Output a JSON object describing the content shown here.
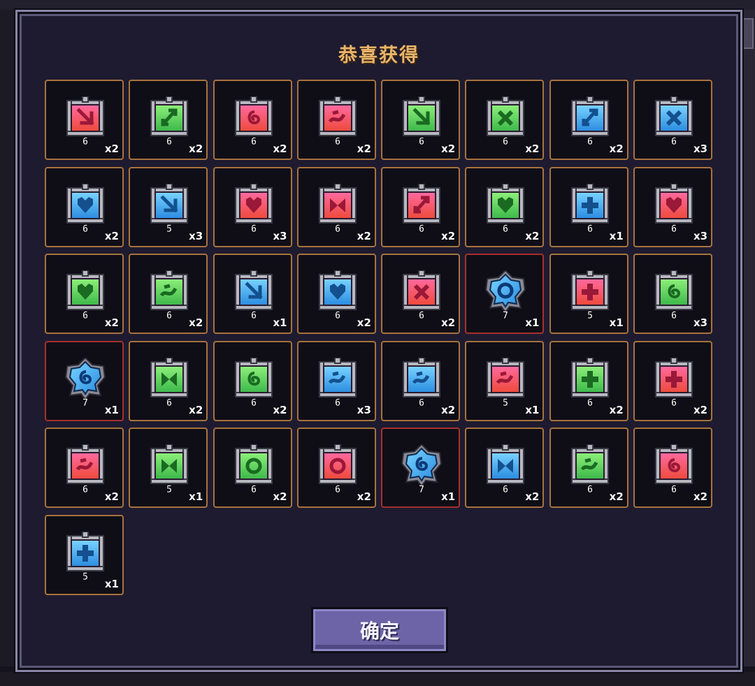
{
  "dialog": {
    "title": "恭喜获得",
    "confirm_label": "确定"
  },
  "colors": {
    "red": {
      "top": "#ff6aa0",
      "bottom": "#ee4a3a",
      "glyph": "#9a1838"
    },
    "green": {
      "top": "#8ef07a",
      "bottom": "#3cb84a",
      "glyph": "#1a6a22"
    },
    "blue": {
      "top": "#7ad4ff",
      "bottom": "#2a8ce0",
      "glyph": "#14508e"
    },
    "frame": "#b8b8c0",
    "cell_border": "#a8733c",
    "special_border": "#a8302c"
  },
  "items": [
    {
      "color": "red",
      "type": "scroll",
      "level": "6",
      "qty": "x2",
      "icon": "arrow-down-right"
    },
    {
      "color": "green",
      "type": "scroll",
      "level": "6",
      "qty": "x2",
      "icon": "slash-arrows"
    },
    {
      "color": "red",
      "type": "scroll",
      "level": "6",
      "qty": "x2",
      "icon": "swirl"
    },
    {
      "color": "red",
      "type": "scroll",
      "level": "6",
      "qty": "x2",
      "icon": "wave"
    },
    {
      "color": "green",
      "type": "scroll",
      "level": "6",
      "qty": "x2",
      "icon": "arrow-down-right"
    },
    {
      "color": "green",
      "type": "scroll",
      "level": "6",
      "qty": "x2",
      "icon": "cross-x"
    },
    {
      "color": "blue",
      "type": "scroll",
      "level": "6",
      "qty": "x2",
      "icon": "slash-arrows"
    },
    {
      "color": "blue",
      "type": "scroll",
      "level": "6",
      "qty": "x3",
      "icon": "cross-x"
    },
    {
      "color": "blue",
      "type": "scroll",
      "level": "6",
      "qty": "x2",
      "icon": "heart"
    },
    {
      "color": "blue",
      "type": "scroll",
      "level": "5",
      "qty": "x3",
      "icon": "arrow-down-right"
    },
    {
      "color": "red",
      "type": "scroll",
      "level": "6",
      "qty": "x3",
      "icon": "heart"
    },
    {
      "color": "red",
      "type": "scroll",
      "level": "6",
      "qty": "x2",
      "icon": "bowtie"
    },
    {
      "color": "red",
      "type": "scroll",
      "level": "6",
      "qty": "x2",
      "icon": "slash-arrows"
    },
    {
      "color": "green",
      "type": "scroll",
      "level": "6",
      "qty": "x2",
      "icon": "heart"
    },
    {
      "color": "blue",
      "type": "scroll",
      "level": "6",
      "qty": "x1",
      "icon": "plus"
    },
    {
      "color": "red",
      "type": "scroll",
      "level": "6",
      "qty": "x3",
      "icon": "heart"
    },
    {
      "color": "green",
      "type": "scroll",
      "level": "6",
      "qty": "x2",
      "icon": "heart"
    },
    {
      "color": "green",
      "type": "scroll",
      "level": "6",
      "qty": "x2",
      "icon": "wave"
    },
    {
      "color": "blue",
      "type": "scroll",
      "level": "6",
      "qty": "x1",
      "icon": "arrow-down-right"
    },
    {
      "color": "blue",
      "type": "scroll",
      "level": "6",
      "qty": "x2",
      "icon": "heart"
    },
    {
      "color": "red",
      "type": "scroll",
      "level": "6",
      "qty": "x2",
      "icon": "cross-x"
    },
    {
      "color": "blue",
      "type": "gem",
      "level": "7",
      "qty": "x1",
      "icon": "ring"
    },
    {
      "color": "red",
      "type": "scroll",
      "level": "5",
      "qty": "x1",
      "icon": "plus"
    },
    {
      "color": "green",
      "type": "scroll",
      "level": "6",
      "qty": "x3",
      "icon": "swirl"
    },
    {
      "color": "blue",
      "type": "gem",
      "level": "7",
      "qty": "x1",
      "icon": "swirl"
    },
    {
      "color": "green",
      "type": "scroll",
      "level": "6",
      "qty": "x2",
      "icon": "bowtie"
    },
    {
      "color": "green",
      "type": "scroll",
      "level": "6",
      "qty": "x2",
      "icon": "swirl"
    },
    {
      "color": "blue",
      "type": "scroll",
      "level": "6",
      "qty": "x3",
      "icon": "wave"
    },
    {
      "color": "blue",
      "type": "scroll",
      "level": "6",
      "qty": "x2",
      "icon": "wave"
    },
    {
      "color": "red",
      "type": "scroll",
      "level": "5",
      "qty": "x1",
      "icon": "wave"
    },
    {
      "color": "green",
      "type": "scroll",
      "level": "6",
      "qty": "x2",
      "icon": "plus"
    },
    {
      "color": "red",
      "type": "scroll",
      "level": "6",
      "qty": "x2",
      "icon": "plus"
    },
    {
      "color": "red",
      "type": "scroll",
      "level": "6",
      "qty": "x2",
      "icon": "wave"
    },
    {
      "color": "green",
      "type": "scroll",
      "level": "5",
      "qty": "x1",
      "icon": "bowtie"
    },
    {
      "color": "green",
      "type": "scroll",
      "level": "6",
      "qty": "x2",
      "icon": "ring"
    },
    {
      "color": "red",
      "type": "scroll",
      "level": "6",
      "qty": "x2",
      "icon": "ring"
    },
    {
      "color": "blue",
      "type": "gem",
      "level": "7",
      "qty": "x1",
      "icon": "swirl"
    },
    {
      "color": "blue",
      "type": "scroll",
      "level": "6",
      "qty": "x2",
      "icon": "bowtie"
    },
    {
      "color": "green",
      "type": "scroll",
      "level": "6",
      "qty": "x2",
      "icon": "wave"
    },
    {
      "color": "red",
      "type": "scroll",
      "level": "6",
      "qty": "x2",
      "icon": "swirl"
    },
    {
      "color": "blue",
      "type": "scroll",
      "level": "5",
      "qty": "x1",
      "icon": "plus"
    }
  ]
}
